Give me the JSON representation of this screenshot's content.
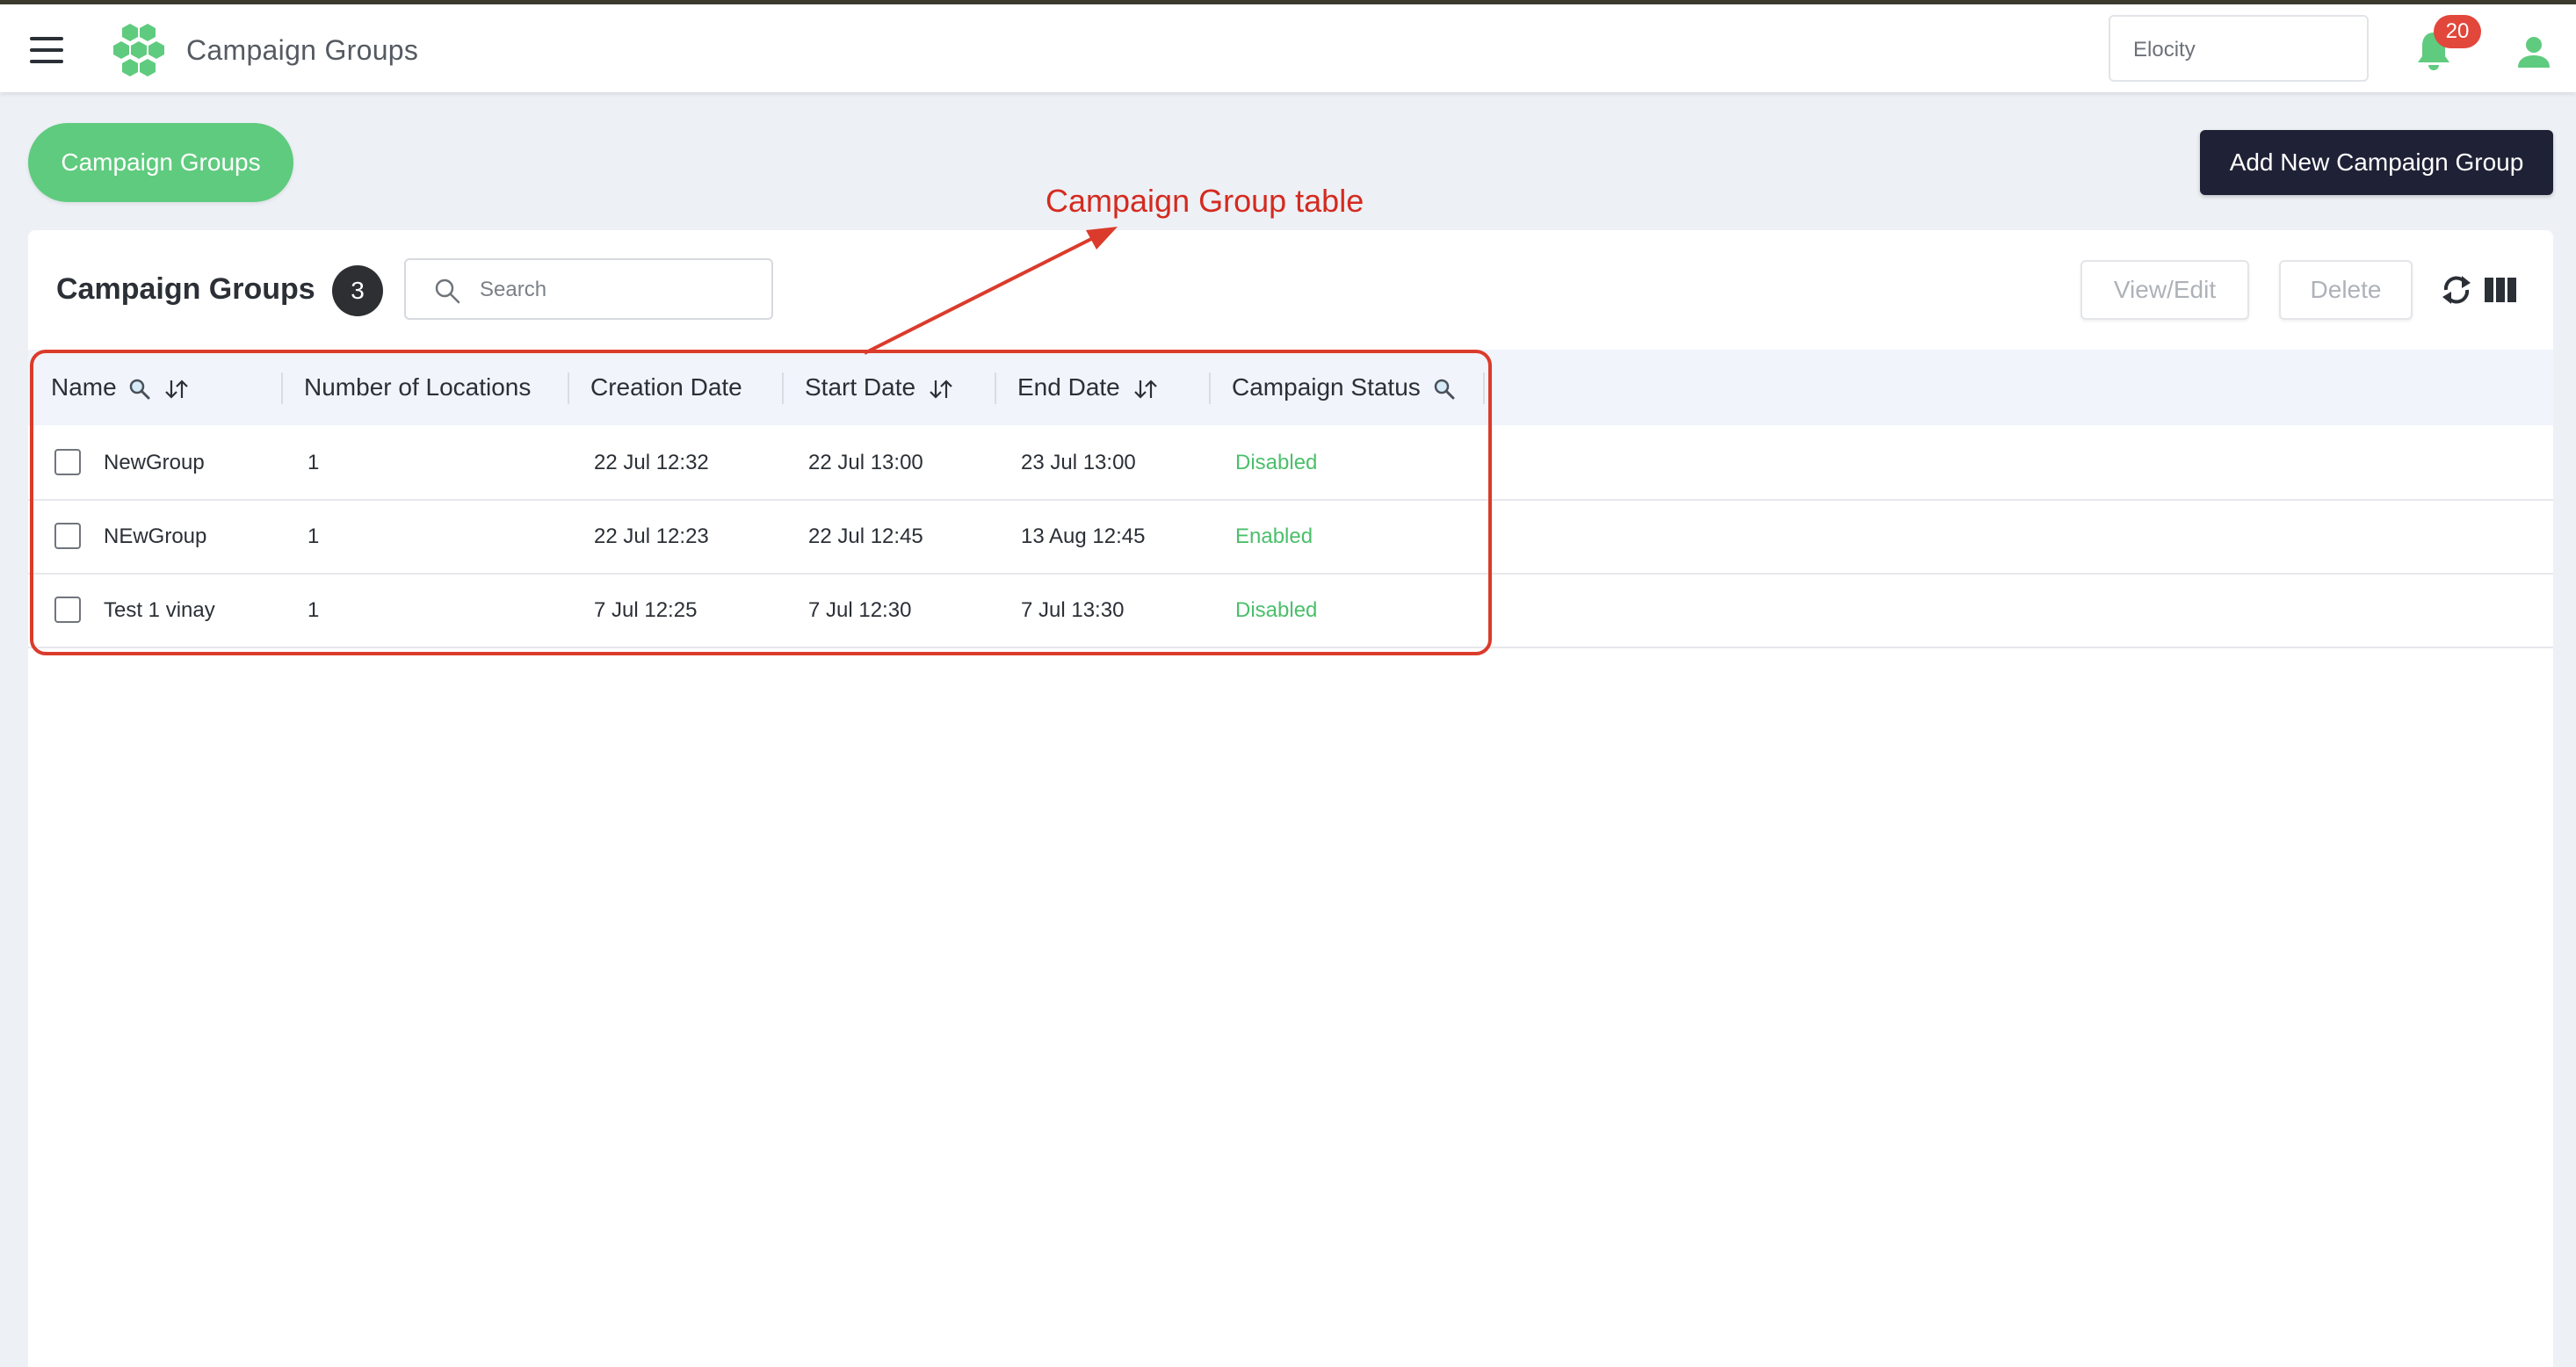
{
  "app": {
    "title": "Campaign Groups",
    "org_select_value": "Elocity",
    "notification_count": "20"
  },
  "toolbar": {
    "campaign_groups_button": "Campaign Groups",
    "add_button": "Add New Campaign Group"
  },
  "annotation": {
    "label": "Campaign Group table",
    "color": "#d42a1f"
  },
  "card": {
    "title": "Campaign Groups",
    "count": "3",
    "search_placeholder": "Search",
    "view_edit_label": "View/Edit",
    "delete_label": "Delete"
  },
  "table": {
    "headers": [
      {
        "label": "Name",
        "icons": [
          "search-icon",
          "sort-icon"
        ]
      },
      {
        "label": "Number of Locations",
        "icons": []
      },
      {
        "label": "Creation Date",
        "icons": []
      },
      {
        "label": "Start Date",
        "icons": [
          "sort-icon"
        ]
      },
      {
        "label": "End Date",
        "icons": [
          "sort-icon"
        ]
      },
      {
        "label": "Campaign Status",
        "icons": [
          "search-icon"
        ]
      }
    ],
    "rows": [
      {
        "name": "NewGroup",
        "locations": "1",
        "created": "22 Jul 12:32",
        "start": "22 Jul 13:00",
        "end": "23 Jul 13:00",
        "status": "Disabled"
      },
      {
        "name": "NEwGroup",
        "locations": "1",
        "created": "22 Jul 12:23",
        "start": "22 Jul 12:45",
        "end": "13 Aug 12:45",
        "status": "Enabled"
      },
      {
        "name": "Test 1 vinay",
        "locations": "1",
        "created": "7 Jul 12:25",
        "start": "7 Jul 12:30",
        "end": "7 Jul 13:30",
        "status": "Disabled"
      }
    ]
  },
  "colors": {
    "accent_green": "#5fcb7e",
    "status_green": "#4bbf6b",
    "dark_button": "#1f2236",
    "badge_red": "#e2473b"
  }
}
